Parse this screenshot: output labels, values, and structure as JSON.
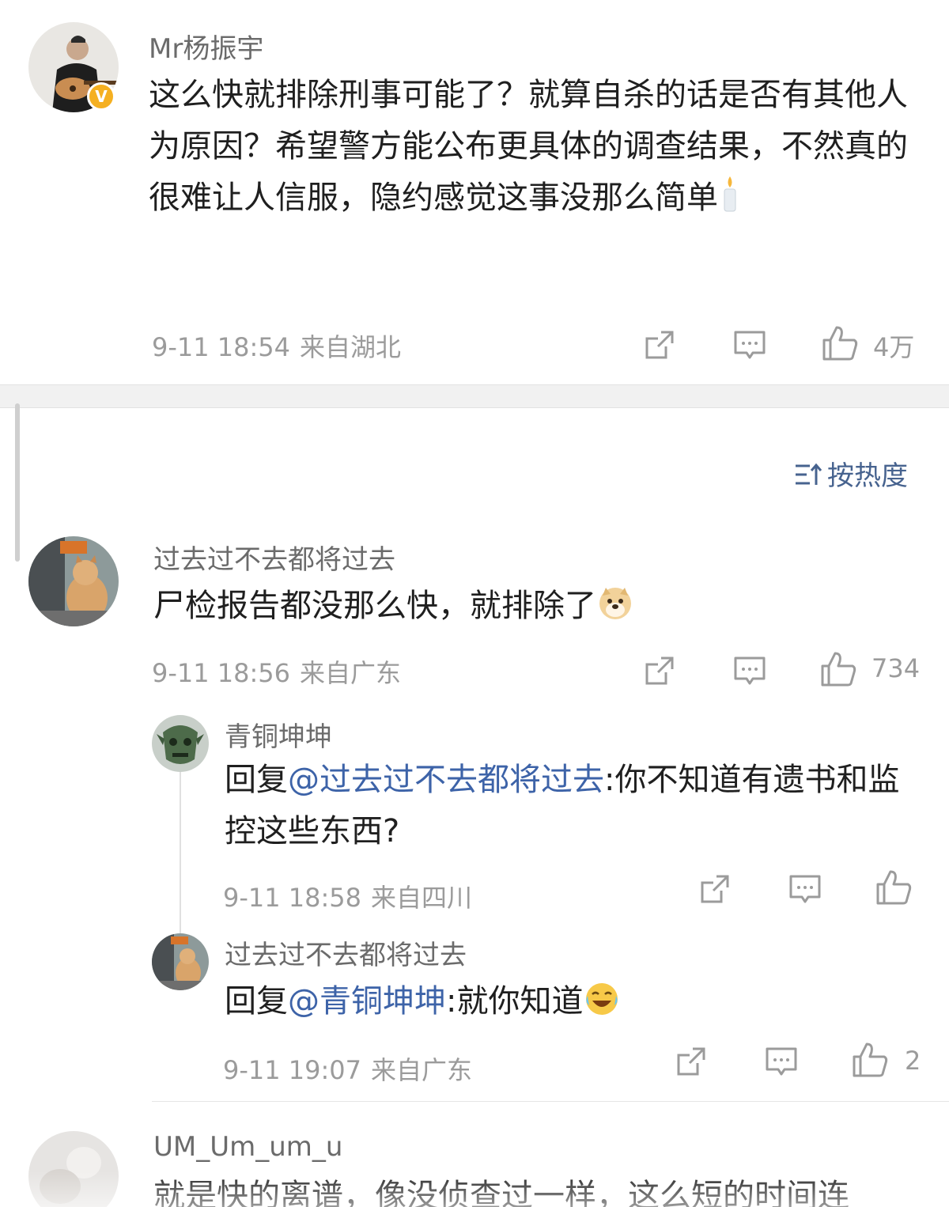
{
  "comments": [
    {
      "username": "Mr杨振宇",
      "verified": true,
      "text": "这么快就排除刑事可能了？就算自杀的话是否有其他人为原因？希望警方能公布更具体的调查结果，不然真的很难让人信服，隐约感觉这事没那么简单",
      "emoji": "candle-emoji",
      "time": "9-11 18:54",
      "location": "来自湖北",
      "likes": "4万"
    },
    {
      "username": "过去过不去都将过去",
      "text": "尸检报告都没那么快，就排除了",
      "emoji": "doge-emoji",
      "time": "9-11 18:56",
      "location": "来自广东",
      "likes": "734",
      "replies": [
        {
          "username": "青铜坤坤",
          "reply_prefix": "回复",
          "mention": "@过去过不去都将过去",
          "text": ":你不知道有遗书和监控这些东西?",
          "time": "9-11 18:58",
          "location": "来自四川",
          "likes": ""
        },
        {
          "username": "过去过不去都将过去",
          "reply_prefix": "回复",
          "mention": "@青铜坤坤",
          "text": ":就你知道",
          "emoji": "laugh-cry-emoji",
          "time": "9-11 19:07",
          "location": "来自广东",
          "likes": "2"
        }
      ]
    },
    {
      "username": "UM_Um_um_u",
      "text": "就是快的离谱，像没侦查过一样，这么短的时间连"
    }
  ],
  "sort": {
    "label": "按热度",
    "icon": "sort-icon"
  },
  "colors": {
    "mention": "#3d63a8",
    "meta": "#9b9b9b",
    "username": "#6b6b6b",
    "verified_badge": "#f5b021"
  }
}
